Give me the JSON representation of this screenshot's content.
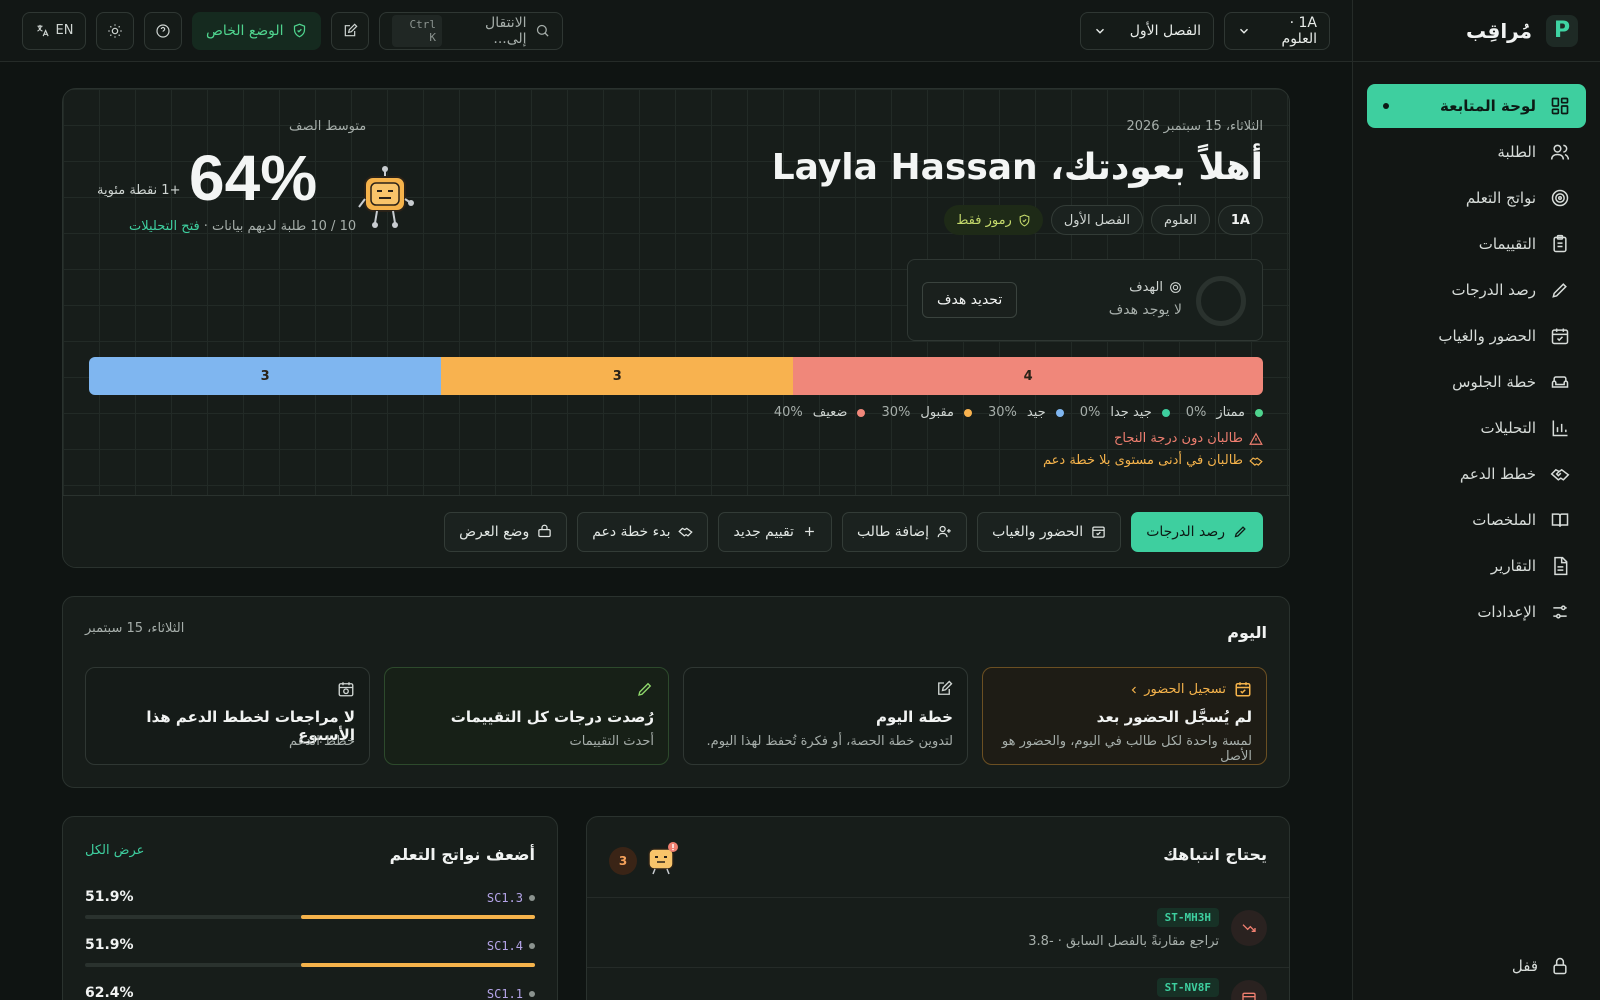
{
  "sidebar": {
    "brand": "مُراقِب",
    "brand_mark": "P",
    "items": [
      {
        "label": "لوحة المتابعة",
        "icon": "dashboard-icon"
      },
      {
        "label": "الطلبة",
        "icon": "users-icon"
      },
      {
        "label": "نواتج التعلم",
        "icon": "target-icon"
      },
      {
        "label": "التقييمات",
        "icon": "clipboard-icon"
      },
      {
        "label": "رصد الدرجات",
        "icon": "pencil-icon"
      },
      {
        "label": "الحضور والغياب",
        "icon": "calendar-check-icon"
      },
      {
        "label": "خطة الجلوس",
        "icon": "sofa-icon"
      },
      {
        "label": "التحليلات",
        "icon": "bar-chart-icon"
      },
      {
        "label": "خطط الدعم",
        "icon": "handshake-icon"
      },
      {
        "label": "الملخصات",
        "icon": "book-icon"
      },
      {
        "label": "التقارير",
        "icon": "file-text-icon"
      },
      {
        "label": "الإعدادات",
        "icon": "sliders-icon"
      }
    ],
    "lock_label": "قفل"
  },
  "topbar": {
    "class_select": "1A · العلوم",
    "term_select": "الفصل الأول",
    "search_placeholder": "الانتقال إلى...",
    "search_shortcut": "Ctrl K",
    "private_mode": "الوضع الخاص",
    "lang": "EN"
  },
  "hero": {
    "date": "الثلاثاء، 15 سبتمبر 2026",
    "greeting": "أهلاً بعودتك، Layla Hassan",
    "chips": [
      "1A",
      "العلوم",
      "الفصل الأول"
    ],
    "codes_only": "رموز فقط",
    "goal_label": "الهدف",
    "goal_value": "لا يوجد هدف",
    "goal_button": "تحديد هدف",
    "avg_label": "متوسط الصف",
    "avg_value": "64%",
    "avg_delta": "+1 نقطة مئوية",
    "avg_meta": "10 / 10 طلبة لديهم بيانات ·",
    "avg_link": "فتح التحليلات",
    "distribution": [
      {
        "label": "ممتاز",
        "pct": "0%",
        "count": 0,
        "color": "#4fd48e"
      },
      {
        "label": "جيد جدا",
        "pct": "0%",
        "count": 0,
        "color": "#3ecf9f"
      },
      {
        "label": "جيد",
        "pct": "30%",
        "count": 3,
        "color": "#7fb6f0"
      },
      {
        "label": "مقبول",
        "pct": "30%",
        "count": 3,
        "color": "#f8b24f"
      },
      {
        "label": "ضعيف",
        "pct": "40%",
        "count": 4,
        "color": "#f0877a"
      }
    ],
    "seg_labels": {
      "good": "3",
      "ok": "3",
      "weak": "4"
    },
    "alert_below_pass": "طالبان دون درجة النجاح",
    "alert_no_support": "طالبان في أدنى مستوى بلا خطة دعم"
  },
  "actions": [
    "رصد الدرجات",
    "الحضور والغياب",
    "إضافة طالب",
    "تقييم جديد",
    "بدء خطة دعم",
    "وضع العرض"
  ],
  "today": {
    "title": "اليوم",
    "date": "الثلاثاء، 15 سبتمبر",
    "cards": [
      {
        "title": "لم يُسجَّل الحضور بعد",
        "sub": "لمسة واحدة لكل طالب في اليوم، والحضور هو الأصل",
        "link": "تسجيل الحضور"
      },
      {
        "title": "خطة اليوم",
        "sub": "لتدوين خطة الحصة، أو فكرة تُحفظ لهذا اليوم."
      },
      {
        "title": "رُصدت درجات كل التقييمات",
        "sub": "أحدث التقييمات"
      },
      {
        "title": "لا مراجعات لخطط الدعم هذا الأسبوع",
        "sub": "خطط الدعم"
      }
    ]
  },
  "attention": {
    "title": "يحتاج انتباهك",
    "count": "3",
    "rows": [
      {
        "code": "ST-MH3H",
        "desc": "تراجع مقارنةً بالفصل السابق · -3.8"
      },
      {
        "code": "ST-NV8F",
        "desc": ""
      }
    ]
  },
  "weakest": {
    "title": "أضعف نواتج التعلم",
    "view_all": "عرض الكل",
    "rows": [
      {
        "code": "SC1.3",
        "value": "51.9%",
        "fraction": 0.519
      },
      {
        "code": "SC1.4",
        "value": "51.9%",
        "fraction": 0.519
      },
      {
        "code": "SC1.1",
        "value": "62.4%",
        "fraction": 0.624
      }
    ]
  }
}
